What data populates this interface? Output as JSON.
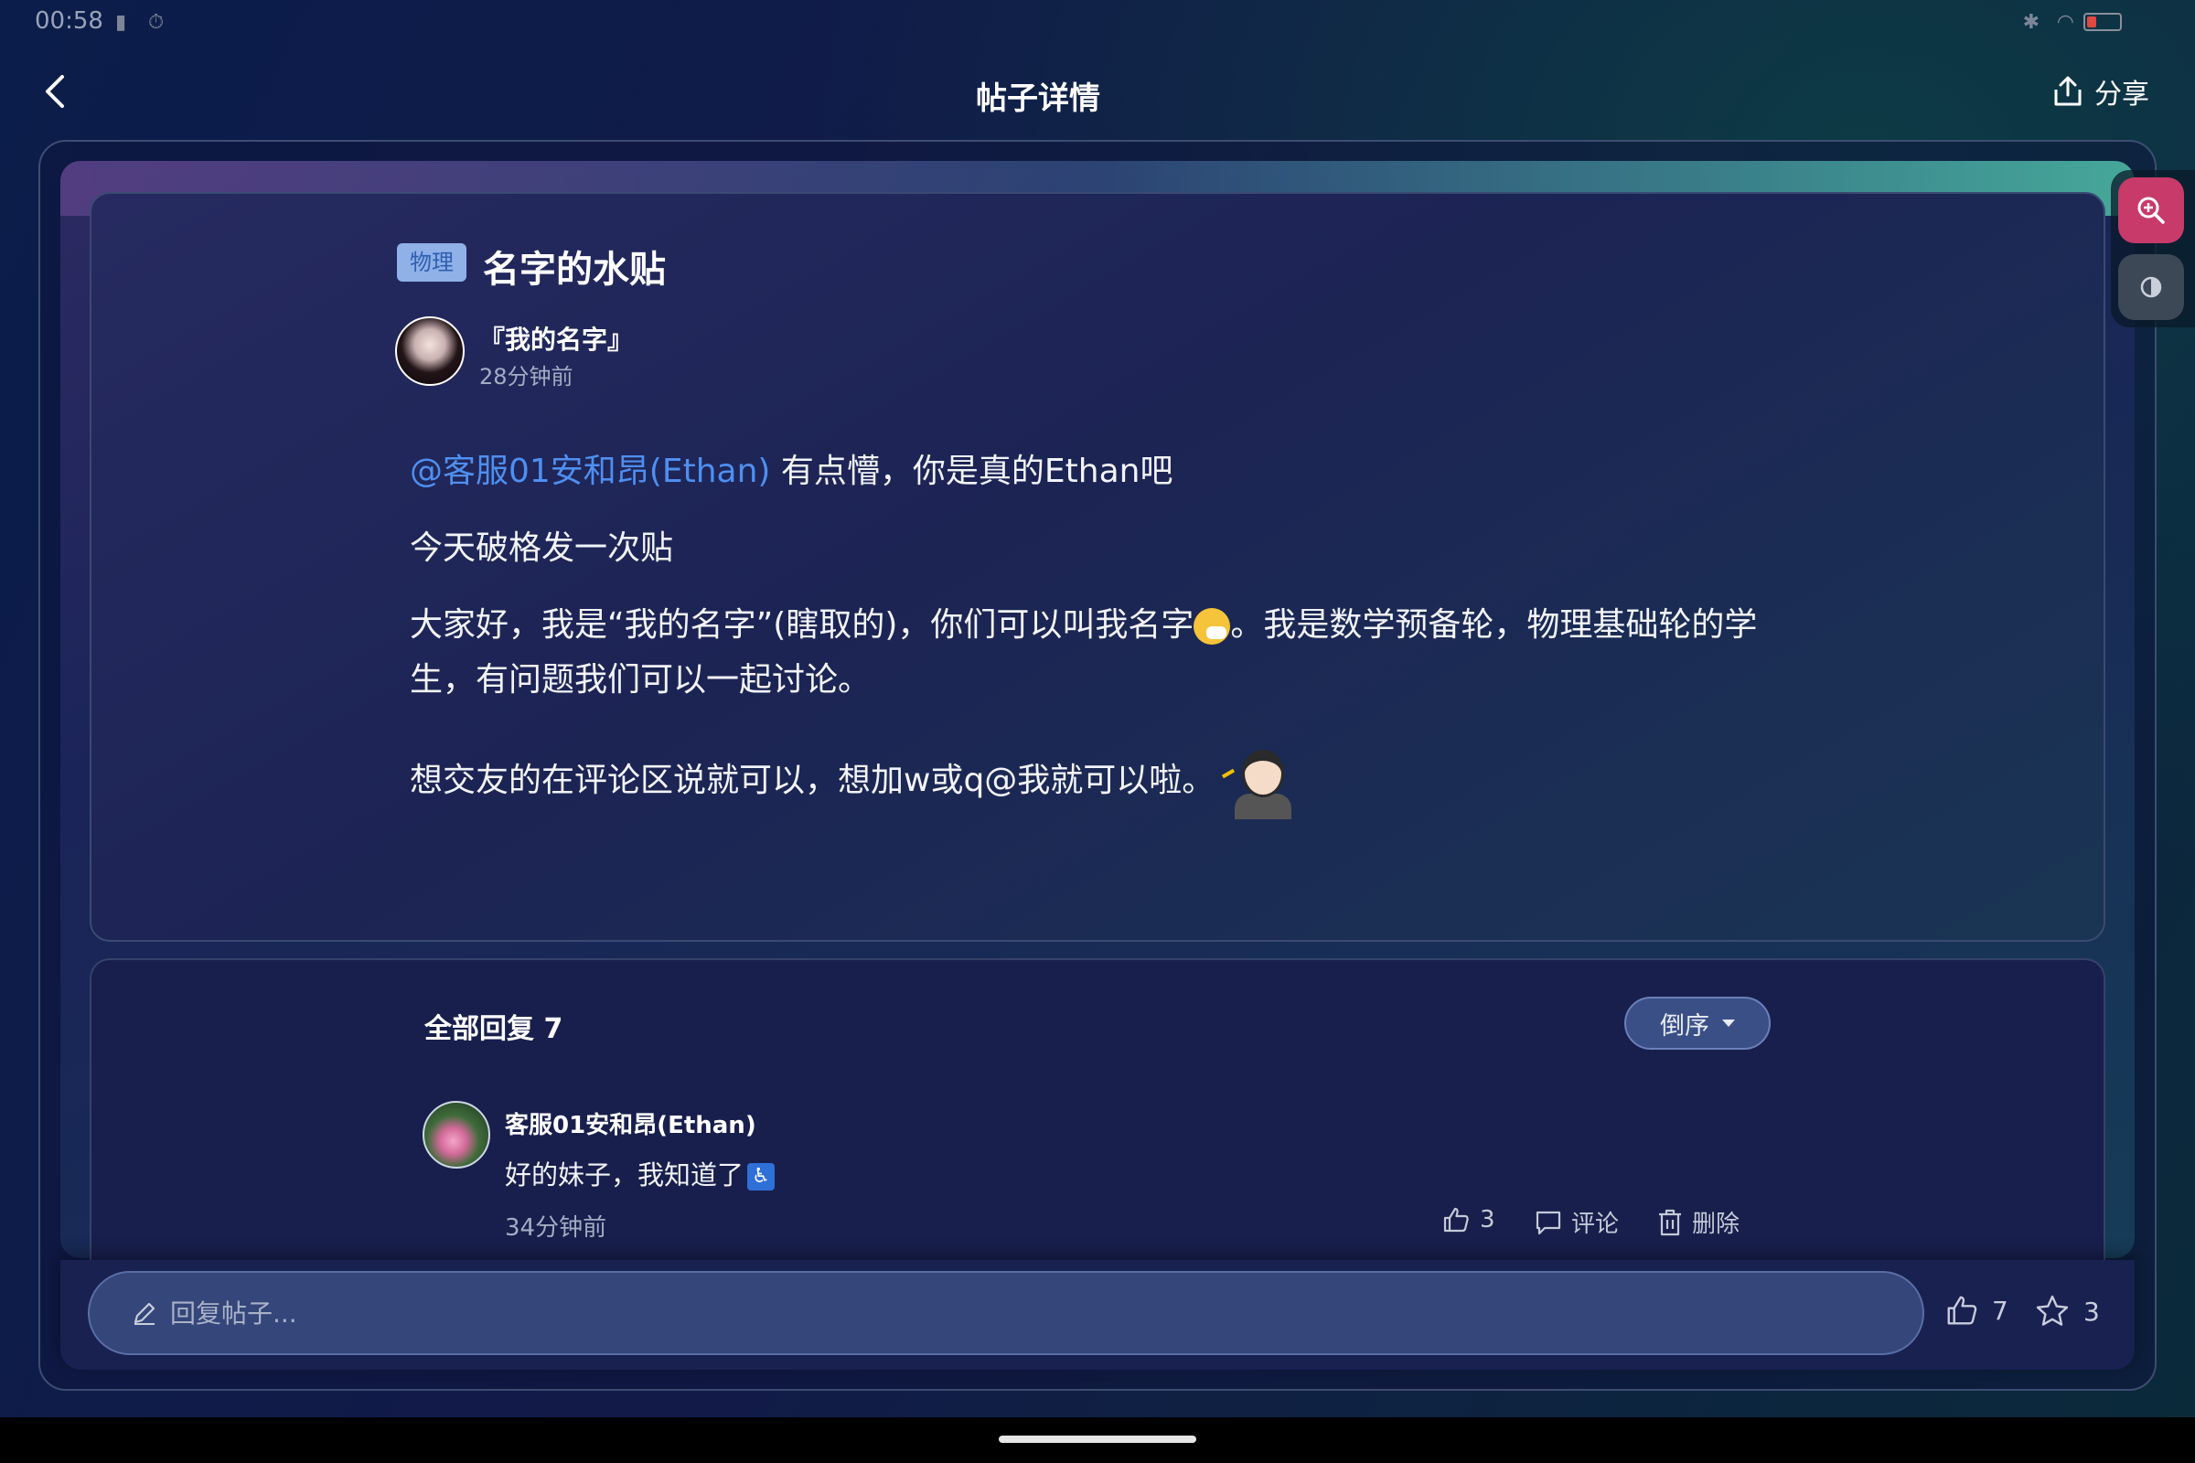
{
  "status_bar": {
    "time": "00:58"
  },
  "header": {
    "title": "帖子详情",
    "share_label": "分享"
  },
  "post": {
    "tag": "物理",
    "title": "名字的水贴",
    "author": "『我的名字』",
    "time": "28分钟前",
    "mention": "@客服01安和昂(Ethan)",
    "line1_rest": " 有点懵，你是真的Ethan吧",
    "line2": "今天破格发一次贴",
    "line3_a": "大家好，我是“我的名字”(瞎取的)，你们可以叫我名字",
    "line3_b": "。我是数学预备轮，物理基础轮的学生，有问题我们可以一起讨论。",
    "line4": "想交友的在评论区说就可以，想加w或q@我就可以啦。"
  },
  "replies": {
    "title": "全部回复 7",
    "sort_label": "倒序",
    "items": [
      {
        "name": "客服01安和昂(Ethan)",
        "text": "好的妹子，我知道了",
        "time": "34分钟前",
        "likes": "3",
        "comment_label": "评论",
        "delete_label": "删除"
      }
    ]
  },
  "bottom_bar": {
    "placeholder": "回复帖子...",
    "likes": "7",
    "favorites": "3"
  },
  "colors": {
    "accent_link": "#4f8ff0",
    "tag_bg": "#8fb1e8",
    "zoom_btn": "#c73a6a"
  }
}
